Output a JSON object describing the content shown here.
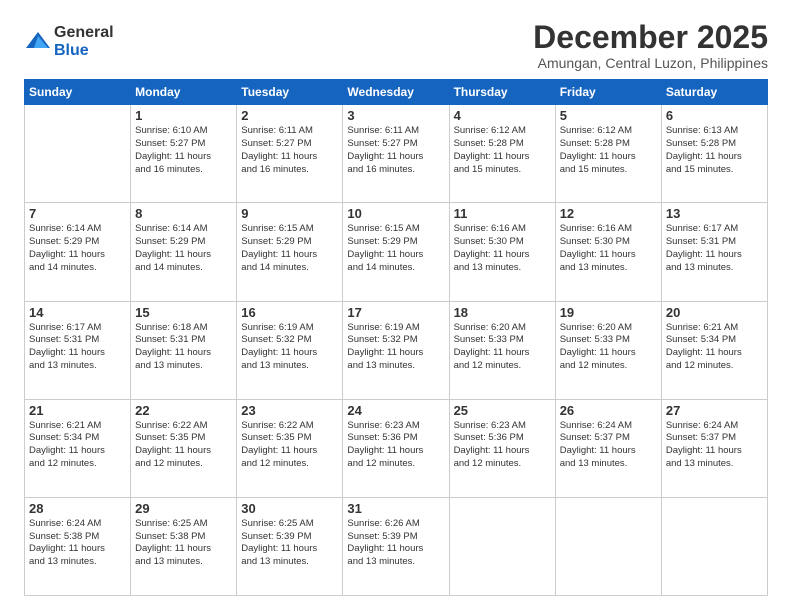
{
  "logo": {
    "general": "General",
    "blue": "Blue"
  },
  "title": "December 2025",
  "subtitle": "Amungan, Central Luzon, Philippines",
  "days_header": [
    "Sunday",
    "Monday",
    "Tuesday",
    "Wednesday",
    "Thursday",
    "Friday",
    "Saturday"
  ],
  "weeks": [
    [
      {
        "day": "",
        "info": ""
      },
      {
        "day": "1",
        "info": "Sunrise: 6:10 AM\nSunset: 5:27 PM\nDaylight: 11 hours\nand 16 minutes."
      },
      {
        "day": "2",
        "info": "Sunrise: 6:11 AM\nSunset: 5:27 PM\nDaylight: 11 hours\nand 16 minutes."
      },
      {
        "day": "3",
        "info": "Sunrise: 6:11 AM\nSunset: 5:27 PM\nDaylight: 11 hours\nand 16 minutes."
      },
      {
        "day": "4",
        "info": "Sunrise: 6:12 AM\nSunset: 5:28 PM\nDaylight: 11 hours\nand 15 minutes."
      },
      {
        "day": "5",
        "info": "Sunrise: 6:12 AM\nSunset: 5:28 PM\nDaylight: 11 hours\nand 15 minutes."
      },
      {
        "day": "6",
        "info": "Sunrise: 6:13 AM\nSunset: 5:28 PM\nDaylight: 11 hours\nand 15 minutes."
      }
    ],
    [
      {
        "day": "7",
        "info": "Sunrise: 6:14 AM\nSunset: 5:29 PM\nDaylight: 11 hours\nand 14 minutes."
      },
      {
        "day": "8",
        "info": "Sunrise: 6:14 AM\nSunset: 5:29 PM\nDaylight: 11 hours\nand 14 minutes."
      },
      {
        "day": "9",
        "info": "Sunrise: 6:15 AM\nSunset: 5:29 PM\nDaylight: 11 hours\nand 14 minutes."
      },
      {
        "day": "10",
        "info": "Sunrise: 6:15 AM\nSunset: 5:29 PM\nDaylight: 11 hours\nand 14 minutes."
      },
      {
        "day": "11",
        "info": "Sunrise: 6:16 AM\nSunset: 5:30 PM\nDaylight: 11 hours\nand 13 minutes."
      },
      {
        "day": "12",
        "info": "Sunrise: 6:16 AM\nSunset: 5:30 PM\nDaylight: 11 hours\nand 13 minutes."
      },
      {
        "day": "13",
        "info": "Sunrise: 6:17 AM\nSunset: 5:31 PM\nDaylight: 11 hours\nand 13 minutes."
      }
    ],
    [
      {
        "day": "14",
        "info": "Sunrise: 6:17 AM\nSunset: 5:31 PM\nDaylight: 11 hours\nand 13 minutes."
      },
      {
        "day": "15",
        "info": "Sunrise: 6:18 AM\nSunset: 5:31 PM\nDaylight: 11 hours\nand 13 minutes."
      },
      {
        "day": "16",
        "info": "Sunrise: 6:19 AM\nSunset: 5:32 PM\nDaylight: 11 hours\nand 13 minutes."
      },
      {
        "day": "17",
        "info": "Sunrise: 6:19 AM\nSunset: 5:32 PM\nDaylight: 11 hours\nand 13 minutes."
      },
      {
        "day": "18",
        "info": "Sunrise: 6:20 AM\nSunset: 5:33 PM\nDaylight: 11 hours\nand 12 minutes."
      },
      {
        "day": "19",
        "info": "Sunrise: 6:20 AM\nSunset: 5:33 PM\nDaylight: 11 hours\nand 12 minutes."
      },
      {
        "day": "20",
        "info": "Sunrise: 6:21 AM\nSunset: 5:34 PM\nDaylight: 11 hours\nand 12 minutes."
      }
    ],
    [
      {
        "day": "21",
        "info": "Sunrise: 6:21 AM\nSunset: 5:34 PM\nDaylight: 11 hours\nand 12 minutes."
      },
      {
        "day": "22",
        "info": "Sunrise: 6:22 AM\nSunset: 5:35 PM\nDaylight: 11 hours\nand 12 minutes."
      },
      {
        "day": "23",
        "info": "Sunrise: 6:22 AM\nSunset: 5:35 PM\nDaylight: 11 hours\nand 12 minutes."
      },
      {
        "day": "24",
        "info": "Sunrise: 6:23 AM\nSunset: 5:36 PM\nDaylight: 11 hours\nand 12 minutes."
      },
      {
        "day": "25",
        "info": "Sunrise: 6:23 AM\nSunset: 5:36 PM\nDaylight: 11 hours\nand 12 minutes."
      },
      {
        "day": "26",
        "info": "Sunrise: 6:24 AM\nSunset: 5:37 PM\nDaylight: 11 hours\nand 13 minutes."
      },
      {
        "day": "27",
        "info": "Sunrise: 6:24 AM\nSunset: 5:37 PM\nDaylight: 11 hours\nand 13 minutes."
      }
    ],
    [
      {
        "day": "28",
        "info": "Sunrise: 6:24 AM\nSunset: 5:38 PM\nDaylight: 11 hours\nand 13 minutes."
      },
      {
        "day": "29",
        "info": "Sunrise: 6:25 AM\nSunset: 5:38 PM\nDaylight: 11 hours\nand 13 minutes."
      },
      {
        "day": "30",
        "info": "Sunrise: 6:25 AM\nSunset: 5:39 PM\nDaylight: 11 hours\nand 13 minutes."
      },
      {
        "day": "31",
        "info": "Sunrise: 6:26 AM\nSunset: 5:39 PM\nDaylight: 11 hours\nand 13 minutes."
      },
      {
        "day": "",
        "info": ""
      },
      {
        "day": "",
        "info": ""
      },
      {
        "day": "",
        "info": ""
      }
    ]
  ]
}
